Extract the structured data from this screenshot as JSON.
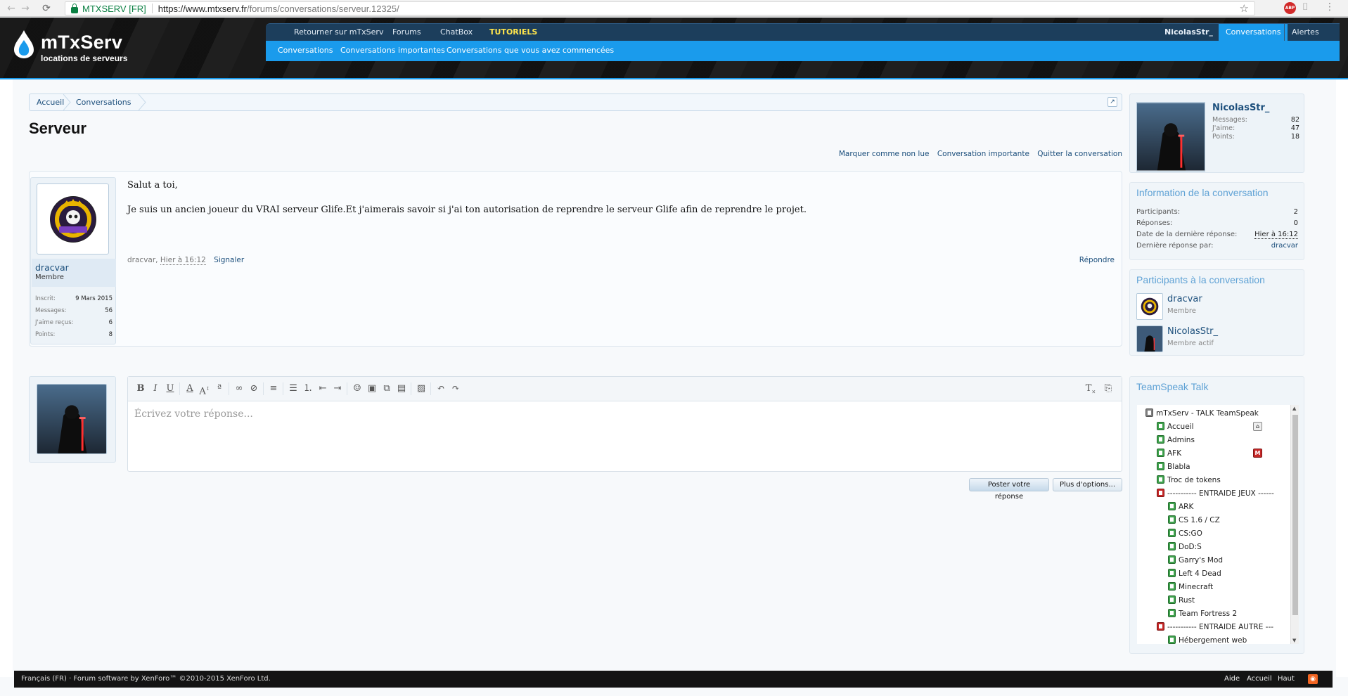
{
  "browser": {
    "site_label": "MTXSERV [FR]",
    "url_host": "https://www.mtxserv.fr",
    "url_path": "/forums/conversations/serveur.12325/",
    "abp_label": "ABP"
  },
  "logo": {
    "title": "mTxServ",
    "subtitle": "locations de serveurs"
  },
  "nav": {
    "tabs": [
      "Retourner sur mTxServ",
      "Forums",
      "ChatBox",
      "TUTORIELS"
    ],
    "user": "NicolasStr_",
    "conversations": "Conversations",
    "alerts": "Alertes",
    "subtabs": [
      "Conversations",
      "Conversations importantes",
      "Conversations que vous avez commencées"
    ]
  },
  "breadcrumb": [
    "Accueil",
    "Conversations"
  ],
  "page_title": "Serveur",
  "actions": [
    "Marquer comme non lue",
    "Conversation importante",
    "Quitter la conversation"
  ],
  "message": {
    "author": "dracvar",
    "author_title": "Membre",
    "stats": [
      {
        "label": "Inscrit:",
        "value": "9 Mars 2015"
      },
      {
        "label": "Messages:",
        "value": "56"
      },
      {
        "label": "J'aime reçus:",
        "value": "6"
      },
      {
        "label": "Points:",
        "value": "8"
      }
    ],
    "body": [
      "Salut a toi,",
      "Je suis un ancien joueur du VRAI serveur Glife.Et j'aimerais savoir si j'ai ton autorisation de reprendre le serveur Glife afin de reprendre le projet."
    ],
    "meta_author": "dracvar,",
    "meta_date": "Hier à 16:12",
    "report": "Signaler",
    "reply": "Répondre"
  },
  "editor": {
    "placeholder": "Écrivez votre réponse...",
    "post_button": "Poster votre réponse",
    "more_button": "Plus d'options..."
  },
  "visitor": {
    "name": "NicolasStr_",
    "stats": [
      {
        "label": "Messages:",
        "value": "82"
      },
      {
        "label": "J'aime:",
        "value": "47"
      },
      {
        "label": "Points:",
        "value": "18"
      }
    ]
  },
  "conversation_info": {
    "title": "Information de la conversation",
    "rows": [
      {
        "label": "Participants:",
        "value": "2"
      },
      {
        "label": "Réponses:",
        "value": "0"
      },
      {
        "label": "Date de la dernière réponse:",
        "value": "Hier à 16:12"
      },
      {
        "label": "Dernière réponse par:",
        "value": "dracvar"
      }
    ]
  },
  "participants": {
    "title": "Participants à la conversation",
    "list": [
      {
        "name": "dracvar",
        "title": "Membre"
      },
      {
        "name": "NicolasStr_",
        "title": "Membre actif"
      }
    ]
  },
  "teamspeak": {
    "title": "TeamSpeak Talk",
    "items": [
      {
        "label": "mTxServ - TALK TeamSpeak",
        "level": 0,
        "icon": "grey"
      },
      {
        "label": "Accueil",
        "level": 1,
        "icon": "green",
        "extra": "home"
      },
      {
        "label": "Admins",
        "level": 1,
        "icon": "green"
      },
      {
        "label": "AFK",
        "level": 1,
        "icon": "green",
        "extra": "M"
      },
      {
        "label": "Blabla",
        "level": 1,
        "icon": "green"
      },
      {
        "label": "Troc de tokens",
        "level": 1,
        "icon": "green"
      },
      {
        "label": "----------- ENTRAIDE JEUX ------",
        "level": 1,
        "icon": "red"
      },
      {
        "label": "ARK",
        "level": 2,
        "icon": "green"
      },
      {
        "label": "CS 1.6 / CZ",
        "level": 2,
        "icon": "green"
      },
      {
        "label": "CS:GO",
        "level": 2,
        "icon": "green"
      },
      {
        "label": "DoD:S",
        "level": 2,
        "icon": "green"
      },
      {
        "label": "Garry's Mod",
        "level": 2,
        "icon": "green"
      },
      {
        "label": "Left 4 Dead",
        "level": 2,
        "icon": "green"
      },
      {
        "label": "Minecraft",
        "level": 2,
        "icon": "green"
      },
      {
        "label": "Rust",
        "level": 2,
        "icon": "green"
      },
      {
        "label": "Team Fortress 2",
        "level": 2,
        "icon": "green"
      },
      {
        "label": "----------- ENTRAIDE AUTRE ---",
        "level": 1,
        "icon": "red"
      },
      {
        "label": "Hébergement web",
        "level": 2,
        "icon": "green"
      }
    ]
  },
  "footer": {
    "left": "Français (FR) · Forum software by XenForo™ ©2010-2015 XenForo Ltd.",
    "links": [
      "Aide",
      "Accueil",
      "Haut"
    ]
  },
  "colors": {
    "accent": "#1a9bec",
    "nav_dark": "#1c3e5c",
    "link": "#1c4f7c",
    "tutoriels": "#ffe64d"
  }
}
